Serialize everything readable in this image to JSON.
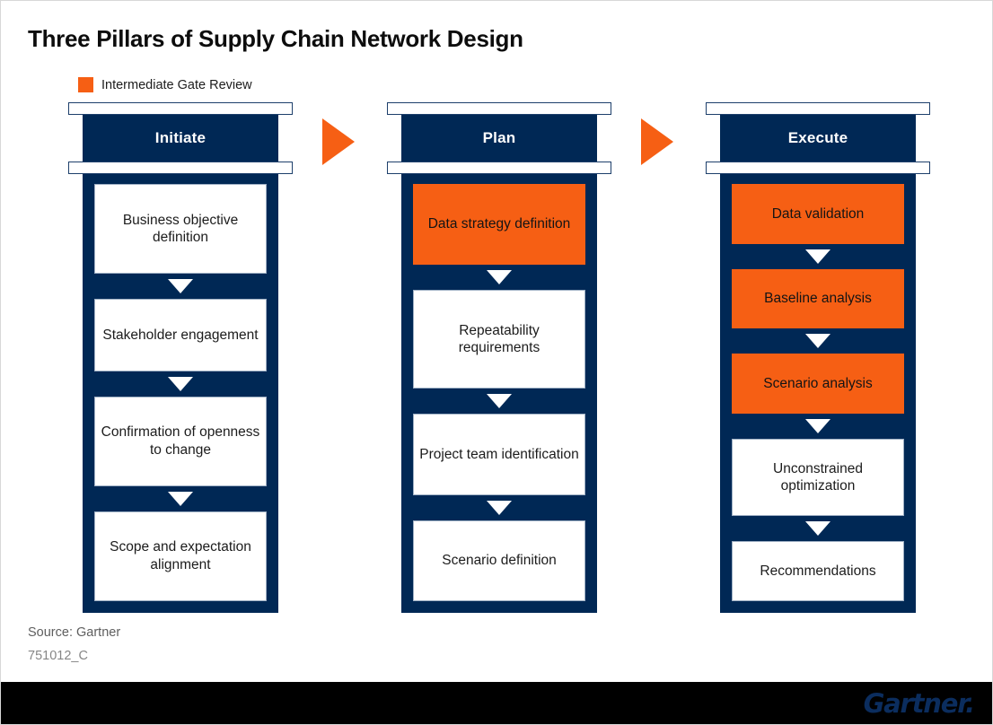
{
  "title": "Three Pillars of Supply Chain Network Design",
  "legend": {
    "swatch_color": "#f65f14",
    "label": "Intermediate Gate Review"
  },
  "colors": {
    "navy": "#002855",
    "orange": "#f65f14",
    "box_border": "#9fb0c4",
    "footer_bar": "#000000",
    "brand_navy": "#0b2d5e"
  },
  "pillars": [
    {
      "header": "Initiate",
      "steps": [
        {
          "label": "Business objective definition",
          "gate": false
        },
        {
          "label": "Stakeholder engagement",
          "gate": false
        },
        {
          "label": "Confirmation of openness to change",
          "gate": false
        },
        {
          "label": "Scope and expectation alignment",
          "gate": false
        }
      ]
    },
    {
      "header": "Plan",
      "steps": [
        {
          "label": "Data strategy definition",
          "gate": true
        },
        {
          "label": "Repeatability requirements",
          "gate": false
        },
        {
          "label": "Project team identification",
          "gate": false
        },
        {
          "label": "Scenario definition",
          "gate": false
        }
      ]
    },
    {
      "header": "Execute",
      "steps": [
        {
          "label": "Data validation",
          "gate": true
        },
        {
          "label": "Baseline analysis",
          "gate": true
        },
        {
          "label": "Scenario analysis",
          "gate": true
        },
        {
          "label": "Unconstrained optimization",
          "gate": false
        },
        {
          "label": "Recommendations",
          "gate": false
        }
      ]
    }
  ],
  "stage_arrows": [
    {
      "name": "initiate-to-plan-arrow"
    },
    {
      "name": "plan-to-execute-arrow"
    }
  ],
  "source": "Source: Gartner",
  "figure_id": "751012_C",
  "brand": "Gartner."
}
